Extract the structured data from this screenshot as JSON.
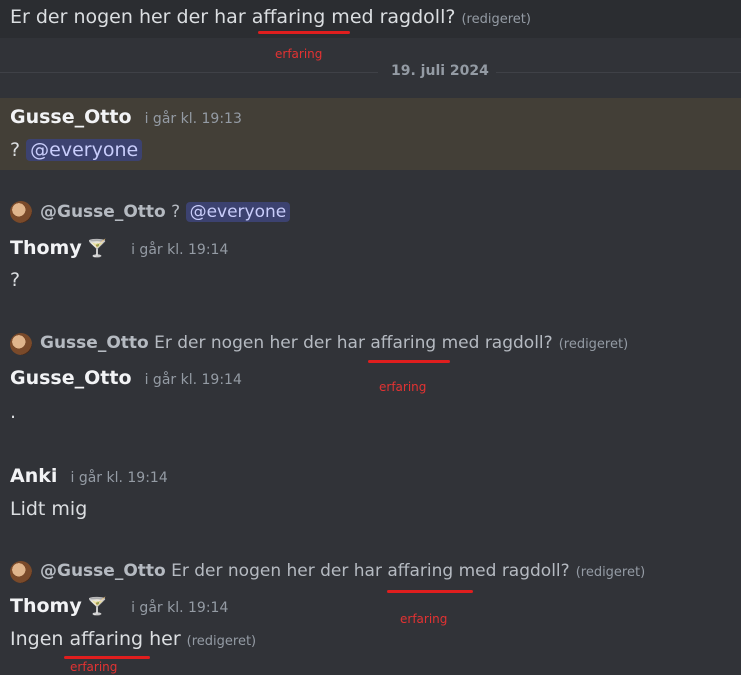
{
  "top_message": {
    "before": "Er der nogen her der har ",
    "wrong_word": "affaring",
    "after": " med ragdoll?",
    "edited": "(redigeret)",
    "correction": "erfaring"
  },
  "date_divider": "19. juli 2024",
  "messages": [
    {
      "author": "Gusse_Otto",
      "timestamp": "i går kl. 19:13",
      "text": "?",
      "mention": "@everyone"
    },
    {
      "reply_to": "@Gusse_Otto",
      "reply_text": "?",
      "reply_mention": "@everyone",
      "author": "Thomy",
      "author_emoji": "🍸",
      "timestamp": "i går kl. 19:14",
      "text": "?"
    },
    {
      "reply_to": "Gusse_Otto",
      "reply_before": "Er der nogen her der har ",
      "reply_wrong_word": "affaring",
      "reply_after": " med ragdoll?",
      "reply_edited": "(redigeret)",
      "reply_correction": "erfaring",
      "author": "Gusse_Otto",
      "timestamp": "i går kl. 19:14",
      "text": "."
    },
    {
      "author": "Anki",
      "timestamp": "i går kl. 19:14",
      "text": "Lidt mig"
    },
    {
      "reply_to": "@Gusse_Otto",
      "reply_before": "Er der nogen her der har ",
      "reply_wrong_word": "affaring",
      "reply_after": " med ragdoll?",
      "reply_edited": "(redigeret)",
      "reply_correction": "erfaring",
      "author": "Thomy",
      "author_emoji": "🍸",
      "timestamp": "i går kl. 19:14",
      "text_before": "Ingen ",
      "text_wrong_word": "affaring",
      "text_after": " her",
      "text_edited": "(redigeret)",
      "text_correction": "erfaring"
    }
  ]
}
